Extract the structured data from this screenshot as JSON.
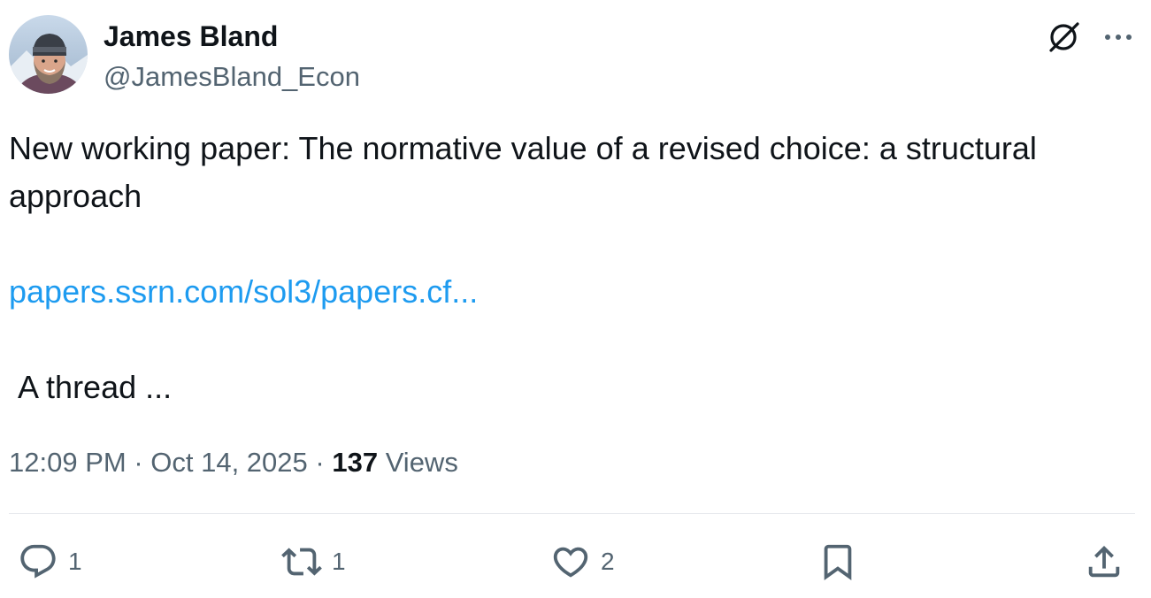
{
  "author": {
    "display_name": "James Bland",
    "handle": "@JamesBland_Econ",
    "avatar": "profile-photo"
  },
  "tweet": {
    "line1": "New working paper: The normative value of a revised choice: a structural approach",
    "link": "papers.ssrn.com/sol3/papers.cf...",
    "line3": " A thread ..."
  },
  "meta": {
    "time": "12:09 PM",
    "separator": " · ",
    "date": "Oct 14, 2025",
    "separator2": " · ",
    "views_count": "137",
    "views_label": " Views"
  },
  "actions": {
    "reply": {
      "icon": "reply-icon",
      "count": "1"
    },
    "repost": {
      "icon": "repost-icon",
      "count": "1"
    },
    "like": {
      "icon": "heart-icon",
      "count": "2"
    },
    "bookmark": {
      "icon": "bookmark-icon"
    },
    "share": {
      "icon": "share-icon"
    }
  },
  "header_icons": [
    "grok-icon",
    "more-icon"
  ],
  "colors": {
    "text": "#0f1419",
    "secondary": "#536471",
    "link": "#1d9bf0",
    "divider": "#e7eaee"
  }
}
